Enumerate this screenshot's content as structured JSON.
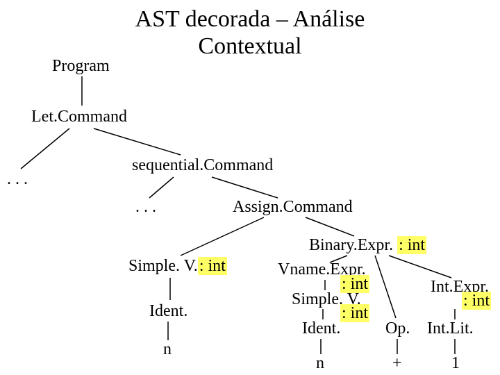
{
  "title": {
    "line1": "AST decorada – Análise",
    "line2": "Contextual"
  },
  "nodes": {
    "program": "Program",
    "letCommand": "Let.Command",
    "dots1": ". . .",
    "seqCommand": "sequential.Command",
    "dots2": ". . .",
    "assignCommand": "Assign.Command",
    "simpleV_left": "Simple. V.",
    "simpleV_left_type": ": int",
    "ident_left": "Ident.",
    "n_left": "n",
    "binaryExpr": "Binary.Expr. ",
    "binaryExpr_type": ": int",
    "vnameExpr": "Vname.Expr.",
    "vnameExpr_type": ": int",
    "simpleV_right": "Simple. V.",
    "simpleV_right_type": ": int",
    "ident_right": "Ident.",
    "n_right": "n",
    "op": "Op.",
    "plus": "+",
    "intExpr": "Int.Expr.",
    "intExpr_type": ": int",
    "intLit": "Int.Lit.",
    "one": "1"
  }
}
